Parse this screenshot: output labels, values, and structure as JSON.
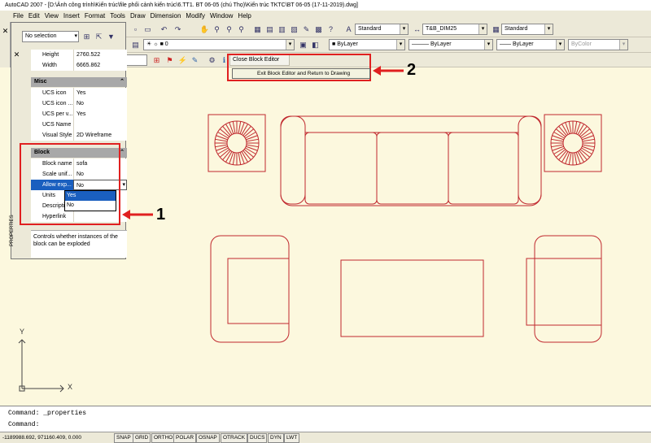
{
  "title": "AutoCAD 2007 - [D:\\Ảnh công trình\\Kiến trúc\\file phối cảnh kiến trúc\\6.TT1. BT 06-05 (chú Thọ)\\Kiến trúc TKTC\\BT 06-05 (17-11-2019).dwg]",
  "menu": [
    "File",
    "Edit",
    "View",
    "Insert",
    "Format",
    "Tools",
    "Draw",
    "Dimension",
    "Modify",
    "Window",
    "Help"
  ],
  "toolbar": {
    "text_style": "Standard",
    "dim_style": "T&B_DIM25",
    "table_style": "Standard",
    "layer": "0",
    "color": "ByLayer",
    "linetype": "ByLayer",
    "lineweight": "ByLayer",
    "plotstyle": "ByColor"
  },
  "block_editor": {
    "close_label": "Close Block Editor",
    "tooltip": "Exit Block Editor and Return to Drawing"
  },
  "properties": {
    "selection": "No selection",
    "tab_label": "PROPERTIES",
    "rows_top": [
      {
        "key": "Height",
        "value": "2760.522"
      },
      {
        "key": "Width",
        "value": "6665.862"
      }
    ],
    "misc_header": "Misc",
    "misc_rows": [
      {
        "key": "UCS icon",
        "value": "Yes"
      },
      {
        "key": "UCS icon ...",
        "value": "No"
      },
      {
        "key": "UCS per v...",
        "value": "Yes"
      },
      {
        "key": "UCS Name",
        "value": ""
      },
      {
        "key": "Visual Style",
        "value": "2D Wireframe"
      }
    ],
    "block_header": "Block",
    "block_rows": [
      {
        "key": "Block name",
        "value": "sofa"
      },
      {
        "key": "Scale unif...",
        "value": "No"
      },
      {
        "key": "Allow exp...",
        "value": "No"
      },
      {
        "key": "Units",
        "value": ""
      },
      {
        "key": "Description",
        "value": ""
      },
      {
        "key": "Hyperlink",
        "value": ""
      }
    ],
    "dropdown_options": [
      "Yes",
      "No"
    ],
    "help_text": "Controls whether instances of the block can be exploded"
  },
  "callouts": {
    "one": "1",
    "two": "2"
  },
  "axes": {
    "x": "X",
    "y": "Y"
  },
  "command": {
    "line1": "Command: _properties",
    "line2": "Command:"
  },
  "status": {
    "coords": "-1189988.692, 971160.409, 0.000",
    "toggles": [
      "SNAP",
      "GRID",
      "ORTHO",
      "POLAR",
      "OSNAP",
      "OTRACK",
      "DUCS",
      "DYN",
      "LWT"
    ]
  },
  "colors": {
    "drawing_line": "#c0282e",
    "canvas": "#fcf8de",
    "annotation": "#e02020",
    "highlight": "#1a5fbf"
  }
}
